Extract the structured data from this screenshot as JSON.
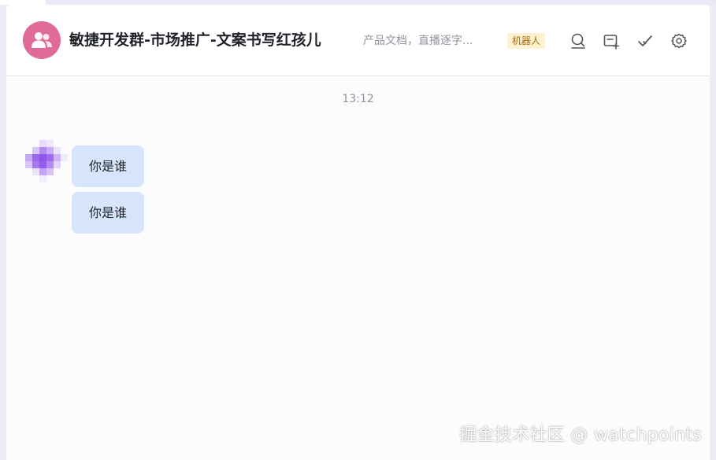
{
  "chat": {
    "group_name": "敏捷开发群-市场推广-文案书写红孩儿",
    "group_desc": "产品文档，直播逐字...",
    "bot_badge": "机器人",
    "header_icons": [
      "search-icon",
      "add-tab-icon",
      "check-icon",
      "settings-icon"
    ]
  },
  "conversation": {
    "timestamp": "13:12",
    "messages": [
      {
        "text": "你是谁"
      },
      {
        "text": "你是谁"
      }
    ]
  },
  "watermark": "掘金技术社区 @ watchpoints",
  "colors": {
    "avatar": "#e06a98",
    "bubble": "#d7e5fc",
    "badge_bg": "#fdf1cf",
    "badge_text": "#a26a0b"
  }
}
